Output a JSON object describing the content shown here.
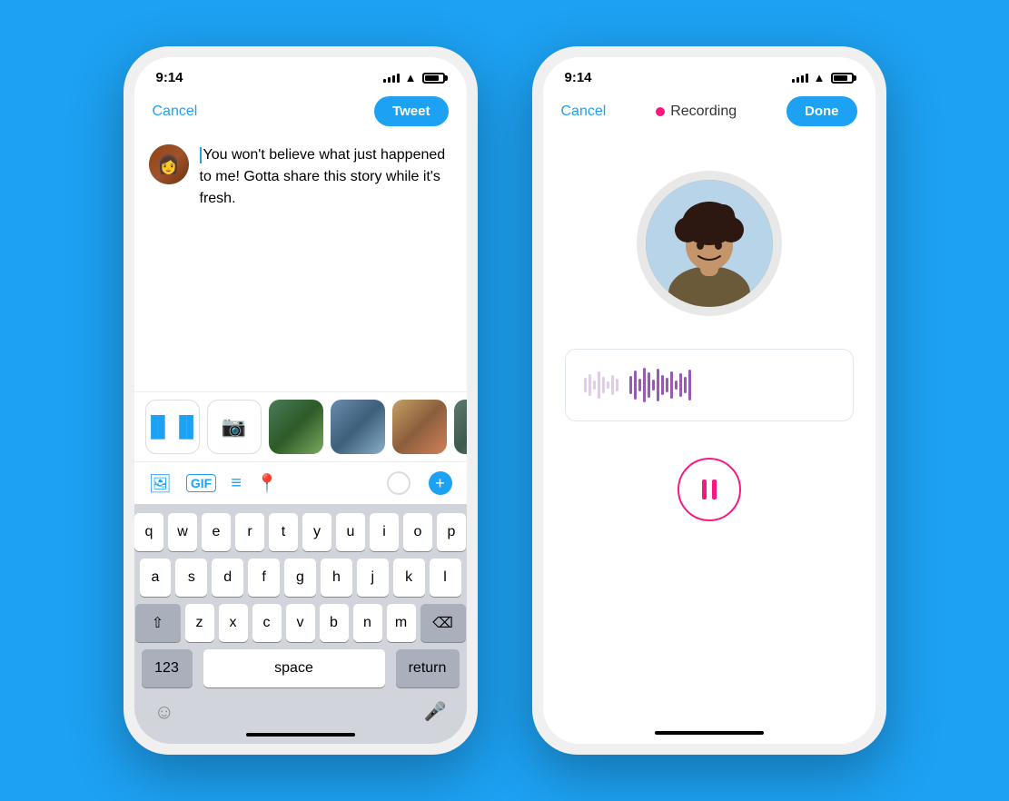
{
  "background_color": "#1DA1F2",
  "phone1": {
    "status_time": "9:14",
    "cancel_label": "Cancel",
    "tweet_label": "Tweet",
    "tweet_text": "You won't believe what just happened to me! Gotta share this story while it's fresh.",
    "toolbar": {
      "image_icon": "🖼",
      "gif_label": "GIF",
      "poll_icon": "≡",
      "location_icon": "📍",
      "plus_icon": "+"
    },
    "keyboard": {
      "row1": [
        "q",
        "w",
        "e",
        "r",
        "t",
        "y",
        "u",
        "i",
        "o",
        "p"
      ],
      "row2": [
        "a",
        "s",
        "d",
        "f",
        "g",
        "h",
        "j",
        "k",
        "l"
      ],
      "row3": [
        "z",
        "x",
        "c",
        "v",
        "b",
        "n",
        "m"
      ],
      "numbers_label": "123",
      "space_label": "space",
      "return_label": "return"
    }
  },
  "phone2": {
    "status_time": "9:14",
    "cancel_label": "Cancel",
    "recording_label": "Recording",
    "done_label": "Done",
    "rec_dot_color": "#F91880",
    "pause_btn_color": "#F91880",
    "waveform_color": "#9b59b6"
  }
}
